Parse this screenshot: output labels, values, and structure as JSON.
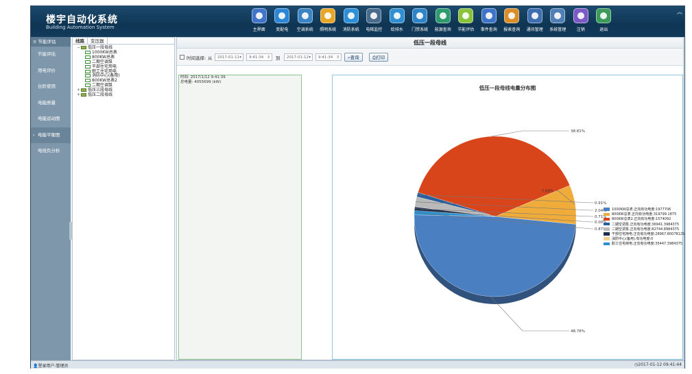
{
  "header": {
    "title": "楼宇自动化系统",
    "subtitle": "Building Automation System",
    "menu": [
      {
        "label": "主界面",
        "icon": "home-icon",
        "color": "#3f74c9"
      },
      {
        "label": "变配电",
        "icon": "power-icon",
        "color": "#2b86d6"
      },
      {
        "label": "空调系统",
        "icon": "aircon-icon",
        "color": "#3b84c4"
      },
      {
        "label": "照明系统",
        "icon": "lightbulb-icon",
        "color": "#e9a526"
      },
      {
        "label": "消防系统",
        "icon": "shield-icon",
        "color": "#2c8fd8"
      },
      {
        "label": "电梯监控",
        "icon": "elevator-icon",
        "color": "#4a6c8c"
      },
      {
        "label": "给排水",
        "icon": "water-icon",
        "color": "#2f8fd0"
      },
      {
        "label": "门禁系统",
        "icon": "access-icon",
        "color": "#2f84c8"
      },
      {
        "label": "能源查询",
        "icon": "monitor-icon",
        "color": "#2e9a6e"
      },
      {
        "label": "节能评估",
        "icon": "document-icon",
        "color": "#8ac23e"
      },
      {
        "label": "事件查询",
        "icon": "screen-icon",
        "color": "#3e74c8"
      },
      {
        "label": "报表查询",
        "icon": "report-icon",
        "color": "#d98e2a"
      },
      {
        "label": "通讯管理",
        "icon": "communication-icon",
        "color": "#3d6fb0"
      },
      {
        "label": "系统管理",
        "icon": "gear-icon",
        "color": "#4f7fb5"
      },
      {
        "label": "注销",
        "icon": "user-icon",
        "color": "#7b5ac6"
      },
      {
        "label": "退出",
        "icon": "exit-icon",
        "color": "#3c9a5b"
      }
    ]
  },
  "sidebar": {
    "title": "节能评估",
    "items": [
      "节能评估",
      "用电评价",
      "台阶使用",
      "电能质量",
      "电能运动图",
      "电能平衡图",
      "电线负分析"
    ],
    "active_index": 5
  },
  "tree": {
    "tabs": [
      "线路",
      "变压器"
    ],
    "nodes": [
      {
        "label": "低压一段母线",
        "level": 1,
        "expand": "−"
      },
      {
        "label": "1000KW总表",
        "level": 2
      },
      {
        "label": "800KW总表",
        "level": 2
      },
      {
        "label": "二期空调泵",
        "level": 2
      },
      {
        "label": "干部住宅用电",
        "level": 2
      },
      {
        "label": "职工住宅用电",
        "level": 2
      },
      {
        "label": "消防中心(备用)",
        "level": 2
      },
      {
        "label": "800KW总表2",
        "level": 2
      },
      {
        "label": "二期空调泵",
        "level": 2
      },
      {
        "label": "低压三段母线",
        "level": 1,
        "expand": "+"
      },
      {
        "label": "低压二段母线",
        "level": 1,
        "expand": "+"
      }
    ]
  },
  "main": {
    "title": "低压一段母线",
    "toolbar": {
      "time_select_label": "时间选择:",
      "from_label": "从",
      "from_date": "2017-01-11",
      "from_time": "9:41:34",
      "to_label": "到",
      "to_date": "2017-01-12",
      "to_time": "9:41:34",
      "query_button": "查询",
      "print_button": "打印"
    },
    "info": {
      "time_line": "时间: 2017/1/12 9:41:39",
      "total_line": "总电量: 4055699 (kW)"
    }
  },
  "chart_data": {
    "type": "pie",
    "title": "低压一段母线电量分布图",
    "series": [
      {
        "name": "1000KW总表.正向有功电度:1977706",
        "value": 48.76,
        "label": "48.76%",
        "color": "#4a7fc1"
      },
      {
        "name": "800KW总表.正向有功电度:319799.1875",
        "value": 7.89,
        "label": "7.89%",
        "color": "#f0ac3a"
      },
      {
        "name": "800KW总表2.正向有功电度:1574092",
        "value": 38.81,
        "label": "38.81%",
        "color": "#d8451a"
      },
      {
        "name": "二期空调泵.正向有功电度:36941.3984375",
        "value": 0.91,
        "label": "0.91%",
        "color": "#2a5f9e"
      },
      {
        "name": "二期空调泵.正向有功电度:82744.8984375",
        "value": 2.04,
        "label": "2.04%",
        "color": "#b9b9b9"
      },
      {
        "name": "干部住宅用电.正向有功电度:28967.80078125",
        "value": 0.71,
        "label": "0.71%",
        "color": "#1e2f4d"
      },
      {
        "name": "消防中心(备用).有功电度:0",
        "value": 0.0,
        "label": "0.00%",
        "color": "#f3d28f"
      },
      {
        "name": "职工住宅用电.正向有功电度:35447.3984375",
        "value": 0.87,
        "label": "0.87%",
        "color": "#2b8fd0"
      }
    ]
  },
  "status": {
    "left": "登录用户:管理员",
    "right": "2017-01-12 09:41:44"
  }
}
